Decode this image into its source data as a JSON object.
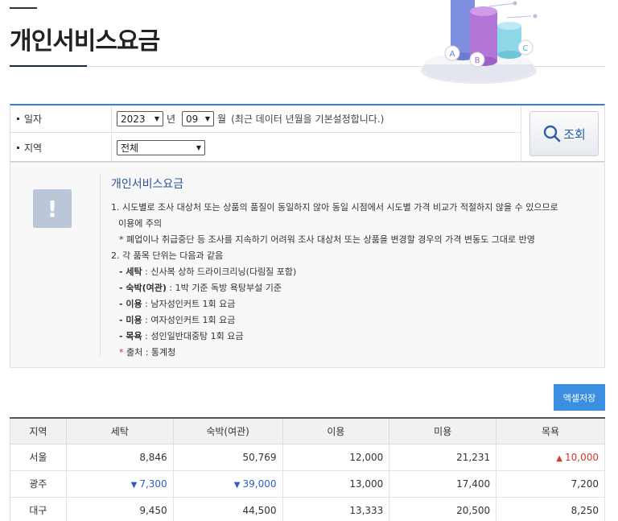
{
  "page": {
    "title": "개인서비스요금"
  },
  "hero": {
    "labels": [
      "A",
      "B",
      "C"
    ]
  },
  "search": {
    "date_label": "일자",
    "year_value": "2023",
    "year_unit": "년",
    "month_value": "09",
    "month_unit": "월",
    "hint": "(최근 데이터 년월을 기본설정합니다.)",
    "region_label": "지역",
    "region_value": "전체",
    "button_label": "조회"
  },
  "notice": {
    "title": "개인서비스요금",
    "line1": "1. 시도별로 조사 대상처 또는 상품의 품질이 동일하지 않아 동일 시점에서 시도별 가격 비교가 적절하지 않을 수 있으므로",
    "line1b": "이용에 주의",
    "line1c": "* 폐업이나 취급중단 등 조사를 지속하기 어려워 조사 대상처 또는 상품을 변경할 경우의 가격 변동도 그대로 반영",
    "line2": "2. 각 품목 단위는 다음과 같음",
    "items": [
      {
        "name": "- 세탁",
        "desc": " : 신사복 상하 드라이크리닝(다림질 포함)"
      },
      {
        "name": "- 숙박(여관)",
        "desc": " : 1박 기준 독방 욕탕부설 기준"
      },
      {
        "name": "- 이용",
        "desc": " : 남자성인커트 1회 요금"
      },
      {
        "name": "- 미용",
        "desc": " : 여자성인커트 1회 요금"
      },
      {
        "name": "- 목욕",
        "desc": " : 성인일반대중탕 1회 요금"
      }
    ],
    "source_star": "*",
    "source": " 출처 : 통계청"
  },
  "excel_button": "액셀저장",
  "table": {
    "headers": [
      "지역",
      "세탁",
      "숙박(여관)",
      "이용",
      "미용",
      "목욕"
    ],
    "rows": [
      {
        "region": "서울",
        "cells": [
          {
            "value": "8,846",
            "trend": ""
          },
          {
            "value": "50,769",
            "trend": ""
          },
          {
            "value": "12,000",
            "trend": ""
          },
          {
            "value": "21,231",
            "trend": ""
          },
          {
            "value": "10,000",
            "trend": "up"
          }
        ]
      },
      {
        "region": "광주",
        "cells": [
          {
            "value": "7,300",
            "trend": "down"
          },
          {
            "value": "39,000",
            "trend": "down"
          },
          {
            "value": "13,000",
            "trend": ""
          },
          {
            "value": "17,400",
            "trend": ""
          },
          {
            "value": "7,200",
            "trend": ""
          }
        ]
      },
      {
        "region": "대구",
        "cells": [
          {
            "value": "9,450",
            "trend": ""
          },
          {
            "value": "44,500",
            "trend": ""
          },
          {
            "value": "13,333",
            "trend": ""
          },
          {
            "value": "20,500",
            "trend": ""
          },
          {
            "value": "8,250",
            "trend": ""
          }
        ]
      }
    ]
  },
  "colors": {
    "accent": "#3a7fd5",
    "up": "#d23a2a",
    "down": "#2a5fc8"
  }
}
